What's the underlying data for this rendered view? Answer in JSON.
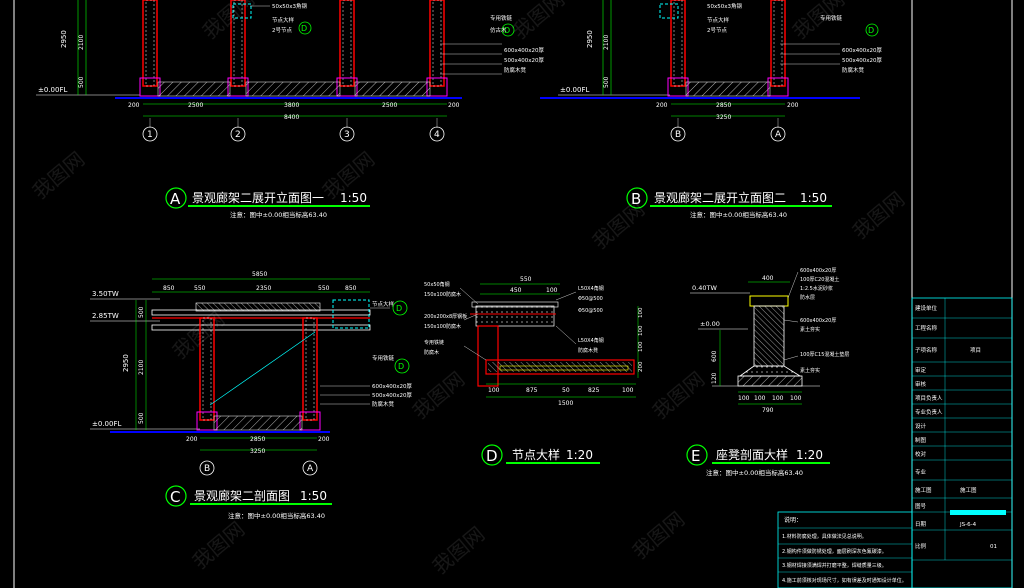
{
  "colors": {
    "background": "#000000",
    "title_text": "#ffffff",
    "title_underline": "#00ff00",
    "dimension": "#ffffff",
    "annotation_yellow": "#ffff00",
    "annotation_green": "#00ff00",
    "column": "#ff0000",
    "column_dashed": "#ffffff",
    "ground": "#0000ff",
    "cyan": "#00ffff",
    "magenta": "#ff00ff",
    "title_block": "#00ffff"
  },
  "drawings": {
    "A": {
      "letter": "A",
      "title": "景观廊架二展开立面图一",
      "scale": "1:50",
      "note": "注意：图中±0.00相当标高63.40",
      "level_label": "±0.00FL",
      "dim_vertical": [
        "2950",
        "2100",
        "500"
      ],
      "dim_bottom": [
        "200",
        "2500",
        "3800",
        "2500",
        "200"
      ],
      "dim_total": "8400",
      "axes": [
        "1",
        "2",
        "3",
        "4"
      ],
      "callouts": [
        "50x50x3角钢",
        "节点大样",
        "2号节点",
        "专用铁链",
        "仿古木",
        "600x400x20厚",
        "500x400x20厚",
        "防腐木凳"
      ],
      "detail_marker": "D"
    },
    "B": {
      "letter": "B",
      "title": "景观廊架二展开立面图二",
      "scale": "1:50",
      "note": "注意：图中±0.00相当标高63.40",
      "level_label": "±0.00FL",
      "dim_vertical": [
        "2950",
        "2100",
        "500"
      ],
      "dim_bottom": [
        "200",
        "2850",
        "200"
      ],
      "dim_total": "3250",
      "axes": [
        "B",
        "A"
      ],
      "callouts": [
        "50x50x3角钢",
        "节点大样",
        "2号节点",
        "专用铁链",
        "600x400x20厚",
        "500x400x20厚",
        "防腐木凳"
      ],
      "detail_marker": "D"
    },
    "C": {
      "letter": "C",
      "title": "景观廊架二剖面图",
      "scale": "1:50",
      "note": "注意：图中±0.00相当标高63.40",
      "levels": [
        "3.50TW",
        "2.85TW",
        "±0.00FL"
      ],
      "dim_top_total": "5850",
      "dim_top": [
        "850",
        "550",
        "2350",
        "550",
        "850"
      ],
      "dim_vertical": [
        "2950",
        "2100",
        "500",
        "500"
      ],
      "dim_bottom": [
        "200",
        "2850",
        "200"
      ],
      "dim_total": "3250",
      "axes": [
        "B",
        "A"
      ],
      "callouts": [
        "节点大样",
        "专用铁链",
        "600x400x20厚",
        "500x400x20厚",
        "防腐木凳"
      ],
      "detail_marker": "D"
    },
    "D": {
      "letter": "D",
      "title": "节点大样",
      "scale": "1:20",
      "dim_top": [
        "550",
        "450",
        "100"
      ],
      "dim_bottom": [
        "100",
        "875",
        "50",
        "825",
        "100"
      ],
      "dim_total": "1500",
      "dim_side": [
        "100",
        "100",
        "100",
        "200"
      ],
      "callouts_left": [
        "50x50角钢",
        "150x100防腐木",
        "200x200x8厚钢板",
        "150x100防腐木",
        "专用铁链",
        "防腐木"
      ],
      "callouts_right": [
        "L50X4角钢",
        "Φ50@500",
        "Φ50@500",
        "L50X4角钢",
        "防腐木凳"
      ]
    },
    "E": {
      "letter": "E",
      "title": "座凳剖面大样",
      "scale": "1:20",
      "note": "注意：图中±0.00相当标高63.40",
      "level_top": "0.40TW",
      "level_mid": "±0.00",
      "dim_top": "400",
      "dim_bottom": [
        "100",
        "100",
        "100",
        "100"
      ],
      "dim_total": "790",
      "dim_side": [
        "600",
        "120"
      ],
      "callouts": [
        "600x400x20厚",
        "100厚C20混凝土",
        "1:2.5水泥砂浆",
        "防水层",
        "600x400x20厚",
        "素土夯实",
        "100厚C15混凝土垫层",
        "素土夯实"
      ]
    }
  },
  "title_block": {
    "rows": [
      "建设单位",
      "工程名称",
      "子项名称",
      "审定",
      "审核",
      "项目负责人",
      "专业负责人",
      "设计",
      "制图",
      "校对",
      "专业",
      "施工图",
      "图号",
      "日期",
      "比例"
    ],
    "stage": "施工图",
    "sheet_code": "JS-6-4",
    "sheet_no": "01",
    "project_label": "项目"
  },
  "notes": {
    "heading": "说明：",
    "items": [
      "1.材料防腐处理，具体做法见总说明。",
      "2.钢构件须做防锈处理，面层刷深灰色氟碳漆。",
      "3.钢材焊接须满焊并打磨平整，焊缝质量三级。",
      "4.施工前须核对现场尺寸，如有误差及时通知设计单位。"
    ]
  },
  "watermark": "我图网"
}
